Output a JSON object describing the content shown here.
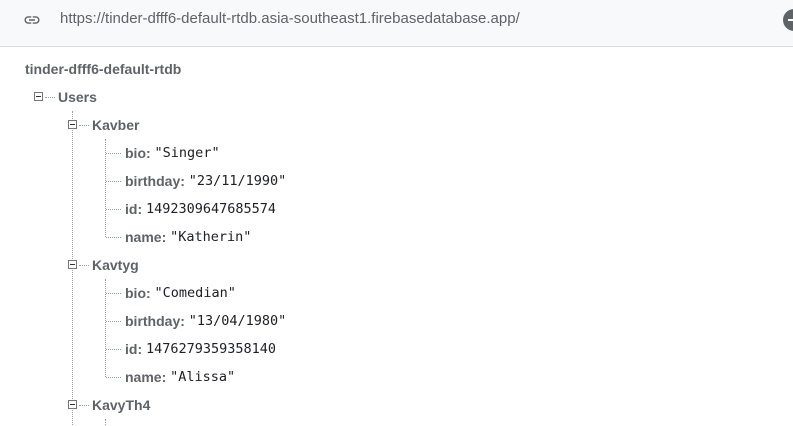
{
  "address_bar": {
    "url": "https://tinder-dfff6-default-rtdb.asia-southeast1.firebasedatabase.app/",
    "link_icon": "link-icon",
    "add_icon": "add-icon"
  },
  "tree": {
    "root": "tinder-dfff6-default-rtdb",
    "node": "Users",
    "users": [
      {
        "key": "Kavber",
        "fields": [
          {
            "key": "bio:",
            "value": "\"Singer\""
          },
          {
            "key": "birthday:",
            "value": "\"23/11/1990\""
          },
          {
            "key": "id:",
            "value": "1492309647685574"
          },
          {
            "key": "name:",
            "value": "\"Katherin\""
          }
        ]
      },
      {
        "key": "Kavtyg",
        "fields": [
          {
            "key": "bio:",
            "value": "\"Comedian\""
          },
          {
            "key": "birthday:",
            "value": "\"13/04/1980\""
          },
          {
            "key": "id:",
            "value": "1476279359358140"
          },
          {
            "key": "name:",
            "value": "\"Alissa\""
          }
        ]
      },
      {
        "key": "KavyTh4",
        "fields": []
      }
    ]
  }
}
